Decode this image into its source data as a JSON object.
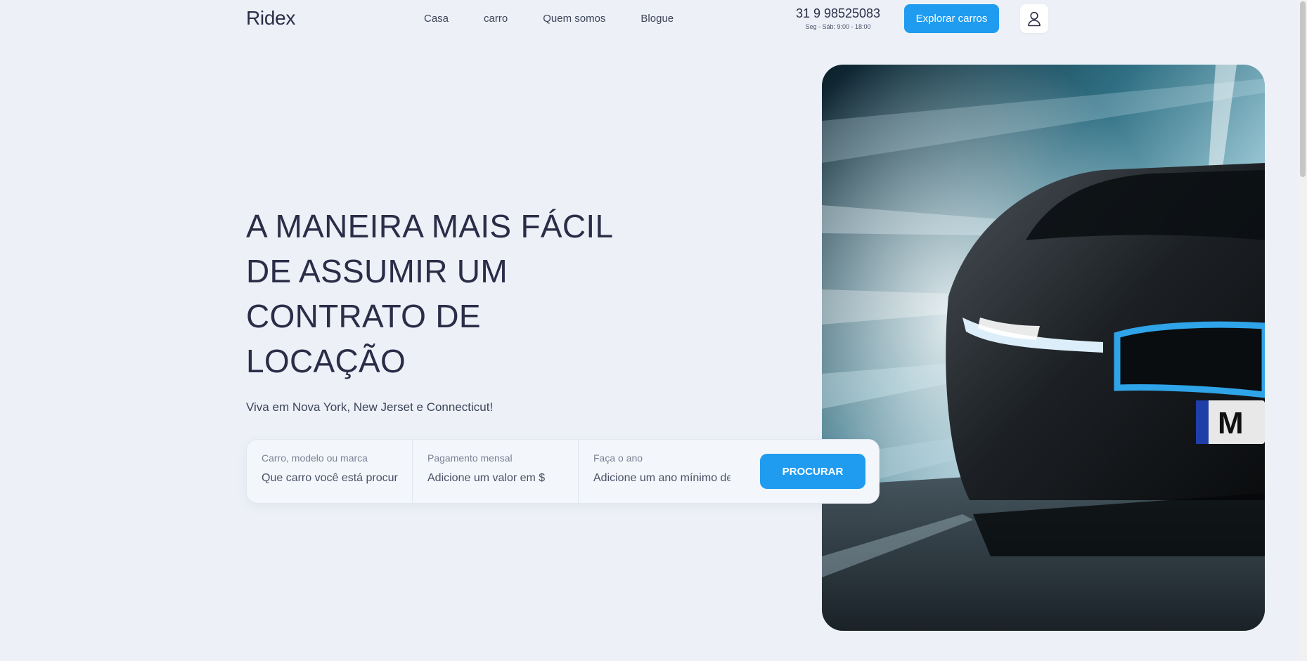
{
  "header": {
    "logo": "Ridex",
    "nav": [
      "Casa",
      "carro",
      "Quem somos",
      "Blogue"
    ],
    "phone": "31 9 98525083",
    "hours": "Seg - Sáb: 9:00 - 18:00",
    "explore_label": "Explorar carros",
    "user_icon": "user-icon"
  },
  "hero": {
    "title": "A MANEIRA MAIS FÁCIL DE ASSUMIR UM CONTRATO DE LOCAÇÃO",
    "subtitle": "Viva em Nova York, New Jerset e Connecticut!"
  },
  "search": {
    "fields": [
      {
        "label": "Carro, modelo ou marca",
        "placeholder": "Que carro você está procura"
      },
      {
        "label": "Pagamento mensal",
        "placeholder": "Adicione um valor em $"
      },
      {
        "label": "Faça o ano",
        "placeholder": "Adicione um ano mínimo de"
      }
    ],
    "button_label": "PROCURAR"
  },
  "colors": {
    "accent": "#1f9cf0",
    "background": "#edf1f7",
    "text": "#2b2d48"
  }
}
